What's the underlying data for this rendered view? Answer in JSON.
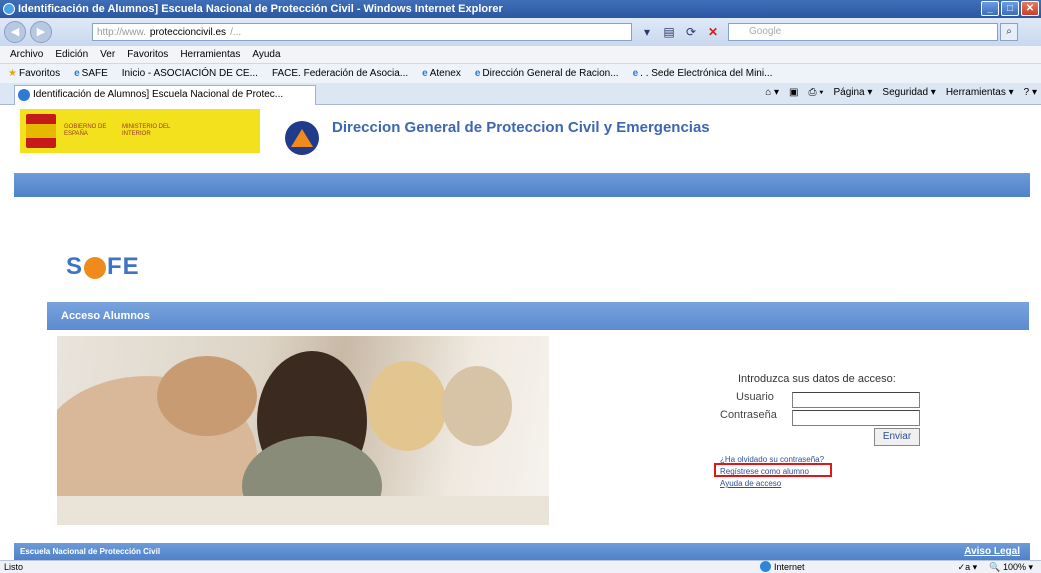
{
  "browser": {
    "title": "Identificación de Alumnos] Escuela Nacional de Protección Civil - Windows Internet Explorer",
    "url_prefix": "http://www.",
    "url_domain": "proteccioncivil.es",
    "url_suffix": "/...",
    "search_placeholder": "Google",
    "menu": [
      "Archivo",
      "Edición",
      "Ver",
      "Favoritos",
      "Herramientas",
      "Ayuda"
    ],
    "favorites": {
      "label": "Favoritos",
      "items": [
        "SAFE",
        "Inicio - ASOCIACIÓN DE CE...",
        "FACE. Federación de Asocia...",
        "Atenex",
        "Dirección General de Racion...",
        ". . Sede Electrónica del Mini..."
      ]
    },
    "tab_title": "Identificación de Alumnos] Escuela Nacional de Protec...",
    "command_bar": [
      "Página ▾",
      "Seguridad ▾",
      "Herramientas ▾"
    ],
    "status_left": "Listo",
    "status_zone": "Internet",
    "zoom": "100%"
  },
  "page": {
    "gov_line1": "GOBIERNO DE ESPAÑA",
    "gov_line2": "MINISTERIO DEL INTERIOR",
    "header_title": "Direccion General de Proteccion Civil y Emergencias",
    "safe_logo": "SAFE",
    "panel_title": "Acceso Alumnos",
    "login_prompt": "Introduzca sus datos de acceso:",
    "user_label": "Usuario",
    "password_label": "Contraseña",
    "submit_label": "Enviar",
    "link_forgot": "¿Ha olvidado su contraseña?",
    "link_register": "Regístrese como alumno",
    "link_help": "Ayuda de acceso",
    "footer_left": "Escuela Nacional de Protección Civil",
    "footer_right": "Aviso Legal"
  }
}
